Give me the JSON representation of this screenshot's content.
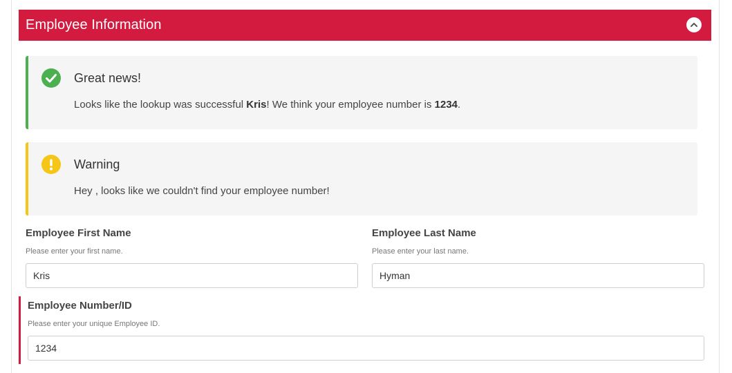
{
  "header": {
    "title": "Employee Information"
  },
  "alerts": {
    "success": {
      "title": "Great news!",
      "msg_prefix": "Looks like the lookup was successful ",
      "name": "Kris",
      "msg_middle": "! We think your employee number is ",
      "number": "1234",
      "msg_suffix": ".",
      "color": "#4caf50",
      "icon": "check-circle-icon"
    },
    "warning": {
      "title": "Warning",
      "msg": "Hey , looks like we couldn't find your employee number!",
      "color": "#f5c518",
      "icon": "exclamation-circle-icon"
    }
  },
  "fields": {
    "first_name": {
      "label": "Employee First Name",
      "help": "Please enter your first name.",
      "value": "Kris"
    },
    "last_name": {
      "label": "Employee Last Name",
      "help": "Please enter your last name.",
      "value": "Hyman"
    },
    "employee_id": {
      "label": "Employee Number/ID",
      "help": "Please enter your unique Employee ID.",
      "value": "1234"
    }
  },
  "colors": {
    "brand": "#d21b3f",
    "alert_bg": "#f5f5f5"
  }
}
